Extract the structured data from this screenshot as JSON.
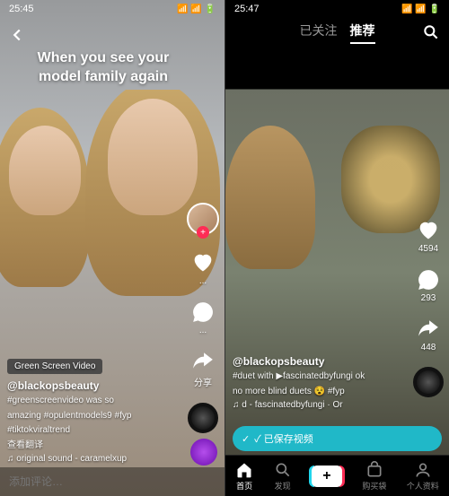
{
  "left": {
    "status_time": "25:45",
    "caption_overlay": "When you see your model family again",
    "green_screen_badge": "Green Screen Video",
    "username": "@blackopsbeauty",
    "description_line1": "#greenscreenvideo was so",
    "description_line2": "amazing #opulentmodels9 #fyp",
    "description_line3": "#tiktokviraltrend",
    "translate_hint": "查看翻译",
    "music": "♫ original sound - caramelxup",
    "rail": {
      "like_count": "...",
      "comment_count": "...",
      "share_label": "分享"
    },
    "comment_placeholder": "添加评论…"
  },
  "right": {
    "status_time": "25:47",
    "tabs": {
      "follow": "已关注",
      "recommend": "推荐"
    },
    "username": "@blackopsbeauty",
    "description_line1": "#duet with ▶fascinatedbyfungi  ok",
    "description_line2": "no more blind duets 😵 #fyp",
    "music": "♫ d - fascinatedbyfungi · Or",
    "rail": {
      "like_count": "4594",
      "comment_count": "293",
      "share_count": "448"
    },
    "saved_banner": "✓ 已保存视频",
    "nav": {
      "home": "首页",
      "discover": "发现",
      "inbox": "购买袋",
      "profile": "个人资料"
    }
  }
}
